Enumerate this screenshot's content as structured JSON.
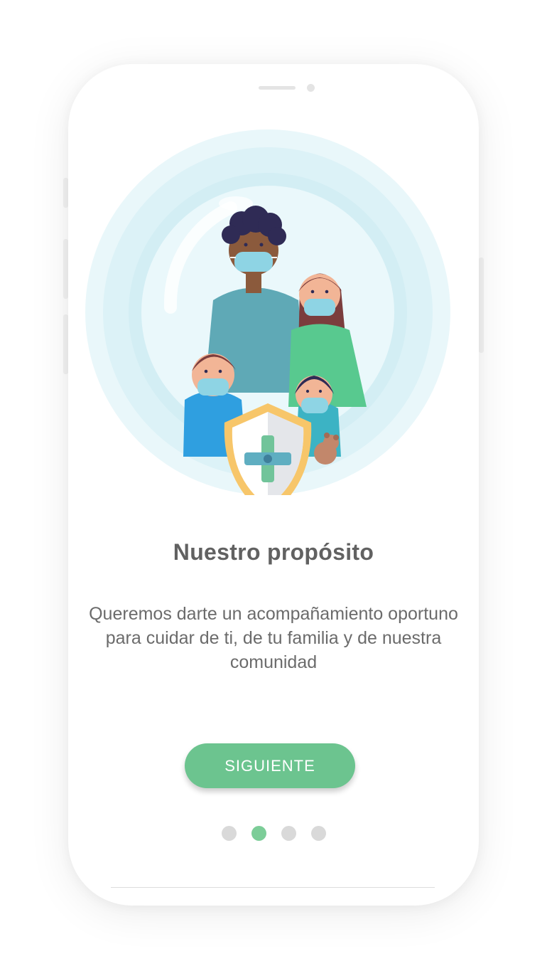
{
  "onboarding": {
    "title": "Nuestro propósito",
    "description": "Queremos darte un acompañamiento oportuno para cuidar de ti, de tu familia y de nuestra comunidad",
    "next_label": "SIGUIENTE",
    "illustration_icon": "family-masks-shield-illustration",
    "pagination": {
      "total": 4,
      "active_index": 1
    }
  },
  "colors": {
    "accent": "#6cc48f",
    "dot_active": "#7ccd98",
    "dot_inactive": "#d9d9d9",
    "title": "#616161",
    "text": "#6b6b6b",
    "bubble": "#dff4f8"
  }
}
